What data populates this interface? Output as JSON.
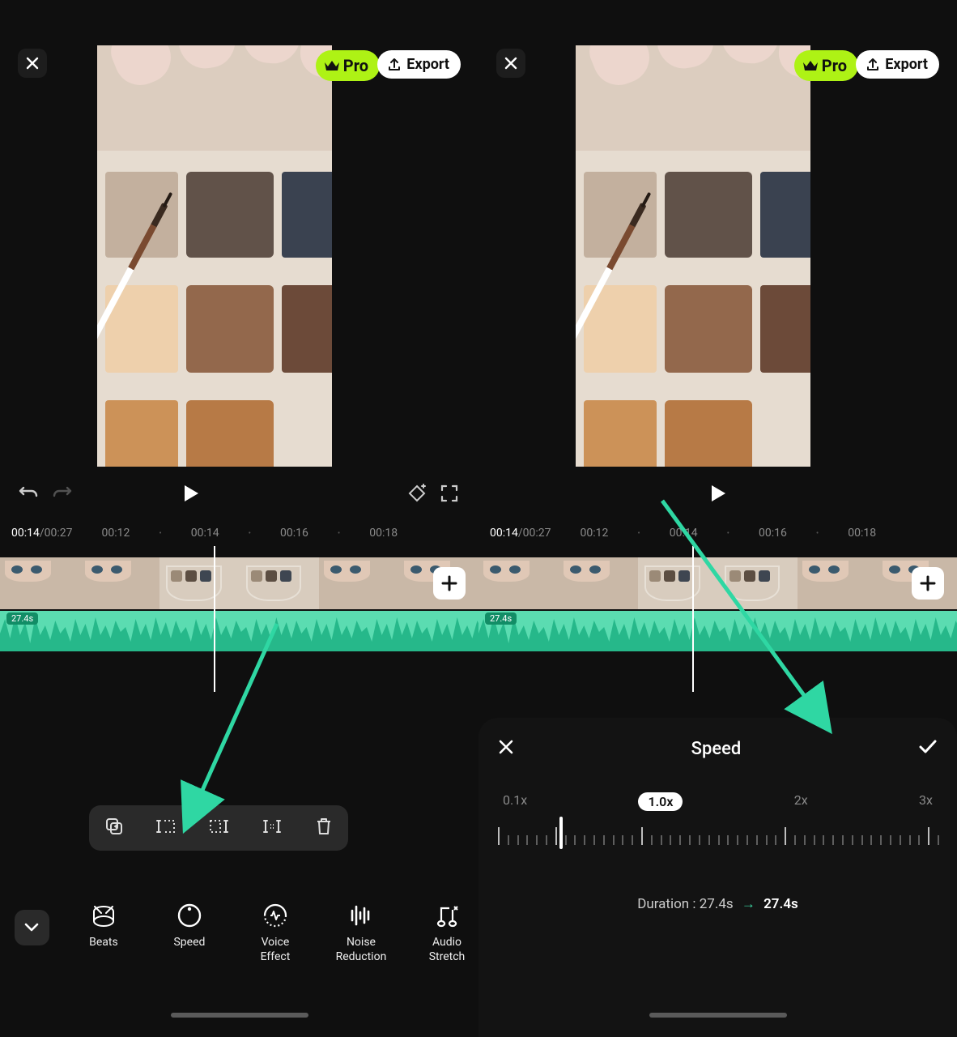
{
  "header": {
    "pro_label": "Pro",
    "export_label": "Export"
  },
  "ruler": {
    "current": "00:14",
    "total": "00:27",
    "marks": [
      "00:12",
      "00:14",
      "00:16",
      "00:18"
    ]
  },
  "wave": {
    "badge": "27.4s"
  },
  "clip_toolbar": {
    "icons": [
      "dup-icon",
      "split-left-icon",
      "split-right-icon",
      "split-out-icon",
      "trash-icon"
    ]
  },
  "tools": [
    {
      "id": "beats",
      "icon": "beats-icon",
      "label": "Beats",
      "label2": ""
    },
    {
      "id": "speed",
      "icon": "speed-icon",
      "label": "Speed",
      "label2": ""
    },
    {
      "id": "voice-effect",
      "icon": "voice-icon",
      "label": "Voice",
      "label2": "Effect"
    },
    {
      "id": "noise-reduction",
      "icon": "noise-icon",
      "label": "Noise",
      "label2": "Reduction"
    },
    {
      "id": "audio-stretch",
      "icon": "stretch-icon",
      "label": "Audio",
      "label2": "Stretch"
    }
  ],
  "speed_panel": {
    "title": "Speed",
    "marks": [
      "0.1x",
      "1.0x",
      "2x",
      "3x"
    ],
    "active_mark_index": 1,
    "knob_percent": 14,
    "duration_label": "Duration :",
    "duration_from": "27.4s",
    "duration_to": "27.4s"
  }
}
